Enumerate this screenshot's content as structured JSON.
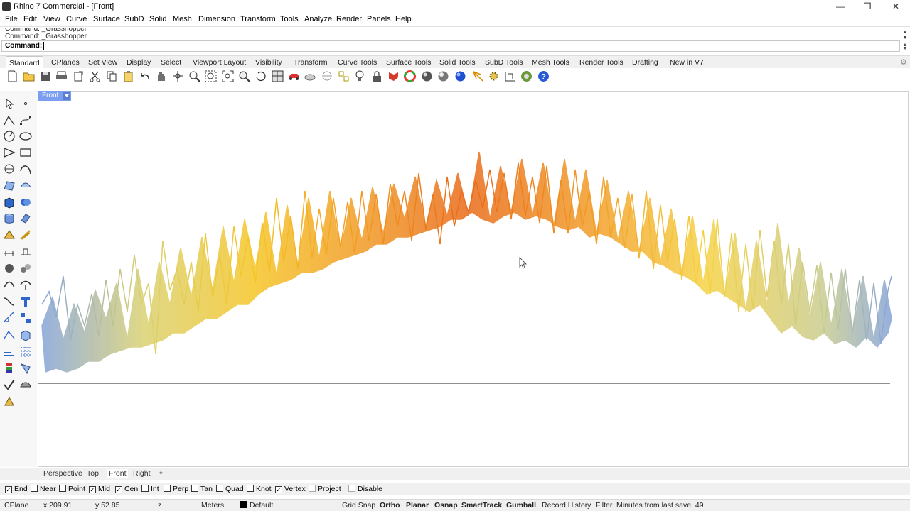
{
  "window": {
    "title": "Rhino 7 Commercial - [Front]"
  },
  "menu": [
    "File",
    "Edit",
    "View",
    "Curve",
    "Surface",
    "SubD",
    "Solid",
    "Mesh",
    "Dimension",
    "Transform",
    "Tools",
    "Analyze",
    "Render",
    "Panels",
    "Help"
  ],
  "command": {
    "history": [
      "Command: _Grasshopper",
      "Command: _Grasshopper"
    ],
    "prompt_label": "Command:",
    "value": ""
  },
  "toolbar_tabs": [
    "Standard",
    "CPlanes",
    "Set View",
    "Display",
    "Select",
    "Viewport Layout",
    "Visibility",
    "Transform",
    "Curve Tools",
    "Surface Tools",
    "Solid Tools",
    "SubD Tools",
    "Mesh Tools",
    "Render Tools",
    "Drafting",
    "New in V7"
  ],
  "active_tab": "Standard",
  "viewport": {
    "name": "Front"
  },
  "viewport_tabs": [
    "Perspective",
    "Top",
    "Front",
    "Right"
  ],
  "osnaps": [
    {
      "label": "End",
      "checked": true
    },
    {
      "label": "Near",
      "checked": false
    },
    {
      "label": "Point",
      "checked": false
    },
    {
      "label": "Mid",
      "checked": true
    },
    {
      "label": "Cen",
      "checked": true
    },
    {
      "label": "Int",
      "checked": false
    },
    {
      "label": "Perp",
      "checked": false
    },
    {
      "label": "Tan",
      "checked": false
    },
    {
      "label": "Quad",
      "checked": false
    },
    {
      "label": "Knot",
      "checked": false
    },
    {
      "label": "Vertex",
      "checked": true
    },
    {
      "label": "Project",
      "checked": false
    },
    {
      "label": "Disable",
      "checked": false
    }
  ],
  "status": {
    "cplane": "CPlane",
    "x": "x 209.91",
    "y": "y 52.85",
    "z": "z",
    "units": "Meters",
    "layer": "Default",
    "grid_snap": "Grid Snap",
    "ortho": "Ortho",
    "planar": "Planar",
    "osnap": "Osnap",
    "smarttrack": "SmartTrack",
    "gumball": "Gumball",
    "record_history": "Record History",
    "filter": "Filter",
    "save_info": "Minutes from last save: 49"
  },
  "colors": {
    "viewport_label": "#7b9ef0",
    "graph_warm": "#e8620c",
    "graph_mid": "#f5c21b",
    "graph_cool": "#7f9fd6"
  }
}
